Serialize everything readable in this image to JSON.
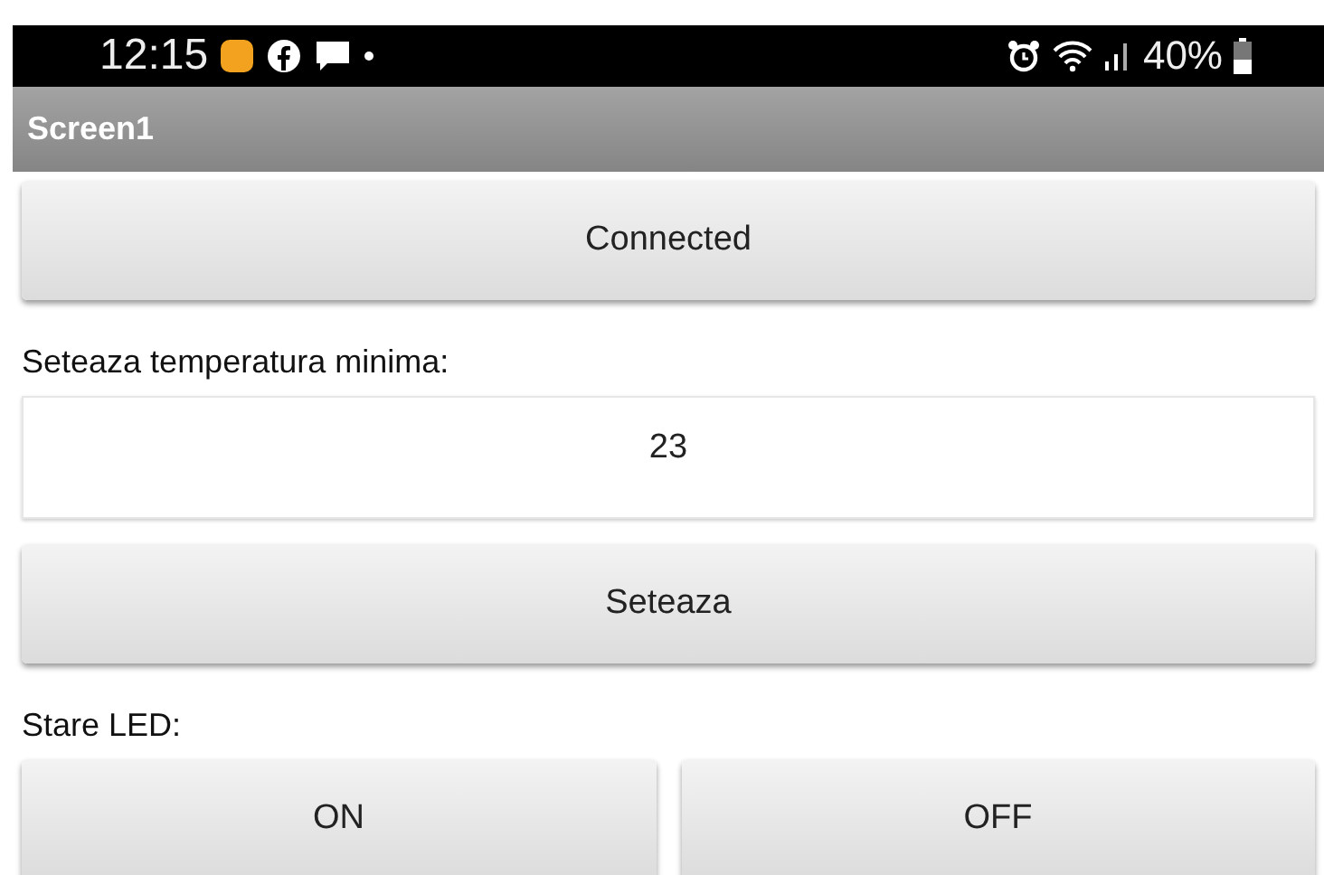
{
  "status_bar": {
    "time": "12:15",
    "battery": "40%"
  },
  "window": {
    "title": "Screen1"
  },
  "connect_button": "Connected",
  "temp_label": "Seteaza temperatura minima:",
  "temp_field": {
    "value": "23"
  },
  "set_button": "Seteaza",
  "led_label": "Stare LED:",
  "led_buttons": [
    "ON",
    "OFF"
  ]
}
